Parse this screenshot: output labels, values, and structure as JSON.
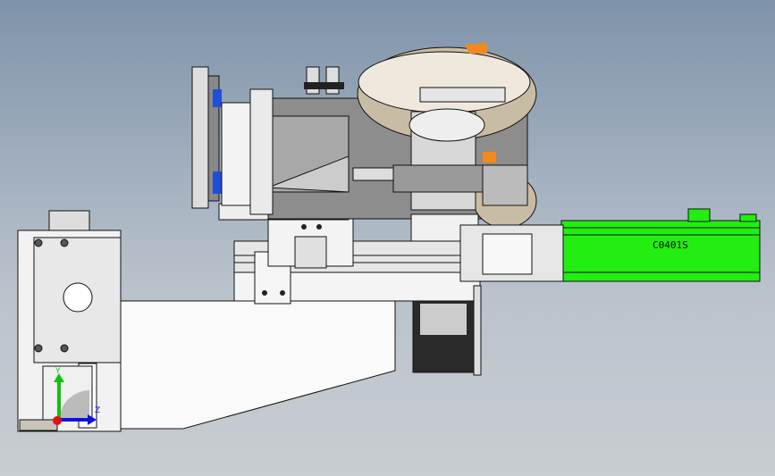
{
  "viewport": {
    "background_top": "#7f93aa",
    "background_bottom": "#c9cdd1"
  },
  "model": {
    "motor_label": "C0401S",
    "motor_color": "#22ee11",
    "accent_orange": "#f08a1c",
    "accent_blue": "#1f4fd8",
    "stepper_color": "#2a2a2a"
  },
  "triad": {
    "y_label": "Y",
    "z_label": "Z",
    "x_color": "#1010e0",
    "y_color": "#10c010",
    "z_color": "#e01010"
  }
}
